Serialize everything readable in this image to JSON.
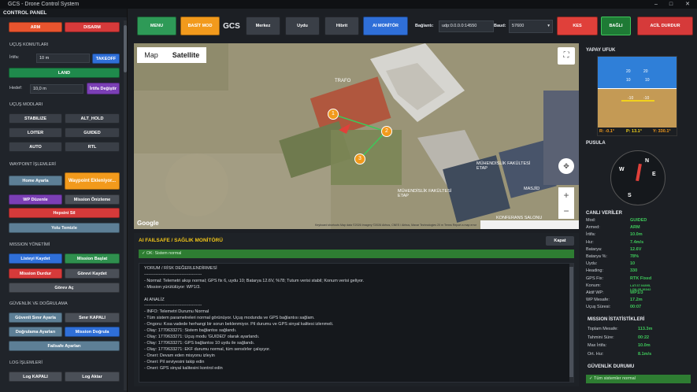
{
  "window": {
    "title": "GCS - Drone Control System",
    "minimize": "–",
    "maximize": "□",
    "close": "✕"
  },
  "left": {
    "header": "CONTROL PANEL",
    "arm": "ARM",
    "disarm": "DISARM",
    "flight_cmds": "UÇUŞ KOMUTLARI",
    "alt_label": "İrtifa:",
    "alt_value": "10 m",
    "takeoff": "TAKEOFF",
    "land": "LAND",
    "target_label": "Hedef:",
    "target_value": "10,0 m",
    "alt_change": "İrtifa Değiştir",
    "flight_modes": "UÇUŞ MODLARI",
    "modes": [
      "STABILIZE",
      "ALT_HOLD",
      "LOITER",
      "GUIDED",
      "AUTO",
      "RTL"
    ],
    "wp_section": "WAYPOINT İŞLEMLERİ",
    "home_set": "Home Ayarla",
    "wp_adding": "Waypoint Ekleniyor...",
    "wp_edit": "WP Düzenle",
    "mission_preview": "Mission Önizleme",
    "clear_all": "Hepsini Sil",
    "clean_path": "Yolu Temizle",
    "mission_section": "MISSION YÖNETİMİ",
    "send_list": "Listeyi Kaydet",
    "start_mission": "Mission Başlat",
    "stop_mission": "Mission Durdur",
    "task_save": "Görevi Kaydet",
    "open_task": "Görev Aç",
    "security_section": "GÜVENLİK VE DOĞRULAMA",
    "safe_limit": "Güvenli Sınır Ayarla",
    "limit_off": "Sınır KAPALI",
    "verify_settings": "Doğrulama Ayarları",
    "verify_mission": "Mission Doğrula",
    "failsafe_settings": "Failsafe Ayarları",
    "log_section": "LOG İŞLEMLERİ",
    "log_off": "Log KAPALI",
    "log_open": "Log Aktar"
  },
  "topbar": {
    "menu": "MENU",
    "basit": "BASİT MOD",
    "gcs": "GCS",
    "center": "Merkez",
    "follow": "Uydu",
    "hybrid": "Hibrit",
    "ai_monitor": "AI MONİTÖR",
    "conn_label": "Bağlantı:",
    "conn_value": "udp:0.0.0.0:14550",
    "baud_label": "Baud:",
    "baud_value": "57600",
    "kes": "KES",
    "bagli": "BAĞLI",
    "emergency": "ACİL DURDUR",
    "colors": {
      "menu": "#2e9a57",
      "basit": "#f29a1c",
      "kes": "#e0403a",
      "bagli": "#1e7a35",
      "emergency": "#d63a3a",
      "ai": "#2f6fd8"
    }
  },
  "map": {
    "tab_map": "Map",
    "tab_sat": "Satellite",
    "labels": [
      "TRAFO",
      "MÜHENDİSLİK FAKÜLTESİ ETAP",
      "MÜHENDİSLİK FAKÜLTESİ ETAP",
      "MASJİD",
      "KONFERANS SALONU"
    ],
    "waypoints": [
      "1",
      "2",
      "3"
    ],
    "google": "Google",
    "attribution": "Keyboard shortcuts   Map data ©2026 Imagery ©2026 Airbus, CNES / Airbus, Maxar Technologies   20 m   Terms   Report a map error",
    "zoom_in": "+",
    "zoom_out": "−"
  },
  "failsafe": {
    "title": "AI FAILSAFE / SAĞLIK MONİTÖRÜ",
    "close": "Kapat",
    "status": "✓ OK: Sistem normal",
    "lines": [
      "YORUM / RİSK DEĞERLENDİRMESİ",
      "----------------------------------------",
      "- Normal: Telemetri akışı normal; GPS fix 6, uydu 10; Batarya 12.6V, %78; Tutum verisi stabil; Konum verisi geliyor.",
      "- Mission yürütülüyor: WP1/3.",
      "",
      "AI ANALİZ",
      "----------------------------------------",
      "- INFO: Telemetri Durumu Normal",
      "- Tüm sistem parametreleri normal görünüyor. Uçuş modunda ve GPS bağlantısı sağlam.",
      "- Ongoru: Kısa vadede herhangi bir sorun beklenmiyor. Pil durumu ve GPS sinyal kalitesi izlenmeli.",
      "- Olay: 1770633271: Sistem bağlantısı sağlandı.",
      "- Olay: 1770633271: Uçuş modu 'GUIDED' olarak ayarlandı.",
      "- Olay: 1770633271: GPS bağlantısı 10 uydu ile sağlandı.",
      "- Olay: 1770633271: EKF durumu normal, tüm sensörler çalışıyor.",
      "- Oneri: Devam eden misyonu izleyin",
      "- Oneri: Pil seviyesini takip edin",
      "- Oneri: GPS sinyal kalitesini kontrol edin"
    ]
  },
  "right": {
    "horizon_title": "YAPAY UFUK",
    "horizon": {
      "roll": "R: -0.1°",
      "pitch": "P: 13.1°",
      "yaw": "Y: 330.1°",
      "ticks": [
        "20",
        "10",
        "10",
        "20",
        "-10",
        "-10"
      ]
    },
    "compass_title": "PUSULA",
    "compass": {
      "n": "N",
      "e": "E",
      "s": "S",
      "w": "W"
    },
    "live_title": "CANLI VERİLER",
    "live": [
      {
        "k": "Mod:",
        "v": "GUIDED"
      },
      {
        "k": "Armed:",
        "v": "ARM"
      },
      {
        "k": "İrtifa:",
        "v": "10.0m"
      },
      {
        "k": "Hız:",
        "v": "7.4m/s"
      },
      {
        "k": "Batarya:",
        "v": "12.6V"
      },
      {
        "k": "Batarya %:",
        "v": "78%"
      },
      {
        "k": "Uydu:",
        "v": "10"
      },
      {
        "k": "Heading:",
        "v": "330"
      },
      {
        "k": "GPS Fix:",
        "v": "RTK Fixed"
      },
      {
        "k": "Konum:",
        "v": "LAT:37.04895, LON:35.36342"
      },
      {
        "k": "Aktif WP:",
        "v": "WP1/3"
      },
      {
        "k": "WP Mesafe:",
        "v": "17.2m"
      },
      {
        "k": "Uçuş Süresi:",
        "v": "00:07"
      }
    ],
    "mission_title": "MISSION İSTATİSTİKLERİ",
    "mission": [
      {
        "k": "Toplam Mesafe:",
        "v": "113.3m"
      },
      {
        "k": "Tahmini Süre:",
        "v": "00:22"
      },
      {
        "k": "Max İrtifa:",
        "v": "10.0m"
      },
      {
        "k": "Ort. Hız:",
        "v": "8.1m/s"
      }
    ],
    "safety_title": "GÜVENLİK DURUMU",
    "safety_status": "✓ Tüm sistemler normal"
  }
}
